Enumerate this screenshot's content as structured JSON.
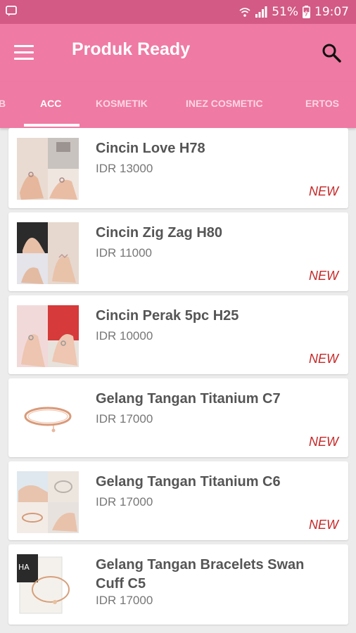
{
  "status_bar": {
    "battery": "51%",
    "time": "19:07"
  },
  "app_bar": {
    "title": "Produk Ready"
  },
  "tabs": [
    {
      "label": "B"
    },
    {
      "label": "ACC"
    },
    {
      "label": "KOSMETIK"
    },
    {
      "label": "INEZ COSMETIC"
    },
    {
      "label": "ERTOS"
    }
  ],
  "products": [
    {
      "name": "Cincin Love H78",
      "price": "IDR 13000",
      "badge": "NEW"
    },
    {
      "name": "Cincin Zig Zag H80",
      "price": "IDR 11000",
      "badge": "NEW"
    },
    {
      "name": "Cincin Perak 5pc H25",
      "price": "IDR 10000",
      "badge": "NEW"
    },
    {
      "name": "Gelang Tangan Titanium C7",
      "price": "IDR 17000",
      "badge": "NEW"
    },
    {
      "name": "Gelang Tangan Titanium C6",
      "price": "IDR 17000",
      "badge": "NEW"
    },
    {
      "name": "Gelang Tangan Bracelets Swan Cuff C5",
      "price": "IDR 17000",
      "badge": ""
    }
  ],
  "colors": {
    "primary": "#ef7aa3",
    "status_bar": "#d25a84",
    "badge": "#c62828"
  }
}
